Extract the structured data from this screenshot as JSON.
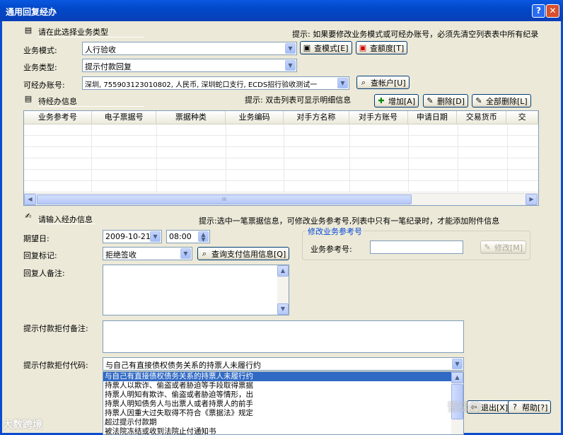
{
  "window": {
    "title": "通用回复经办",
    "help_glyph": "?",
    "close_glyph": "✕"
  },
  "section1": {
    "title": "请在此选择业务类型",
    "hint": "提示: 如果要修改业务模式或可经办账号，必须先清空列表表中所有纪录"
  },
  "form": {
    "mode_label": "业务模式:",
    "mode_value": "人行验收",
    "type_label": "业务类型:",
    "type_value": "提示付款回复",
    "account_label": "可经办账号:",
    "account_value": "深圳, 755903123010802, 人民币, 深圳蛇口支行, ECDS招行验收测试一"
  },
  "buttons": {
    "query_mode": "查模式[E]",
    "query_quota": "查额度[T]",
    "query_account": "查帐户[U]",
    "add": "增加[A]",
    "delete": "删除[D]",
    "delete_all": "全部删除[L]",
    "query_pay_info": "查询支付信用信息[Q]",
    "modify": "修改[M]",
    "exit": "退出[X]",
    "help": "帮助[?]"
  },
  "section2": {
    "title": "待经办信息",
    "hint": "提示: 双击列表可显示明细信息"
  },
  "table": {
    "columns": [
      "业务参考号",
      "电子票据号",
      "票据种类",
      "业务编码",
      "对手方名称",
      "对手方账号",
      "申请日期",
      "交易货币",
      "交"
    ],
    "scroll_thumb": "III"
  },
  "section3": {
    "title": "请输入经办信息",
    "hint": "提示:选中一笔票据信息，可修改业务参考号,列表中只有一笔纪录时，才能添加附件信息"
  },
  "entry": {
    "date_label": "期望日:",
    "date_value": "2009-10-21",
    "time_value": "08:00",
    "reply_flag_label": "回复标记:",
    "reply_flag_value": "拒绝签收",
    "remark_label": "回复人备注:",
    "reject_remark_label": "提示付款拒付备注:",
    "reject_code_label": "提示付款拒付代码:",
    "reject_code_value": "与自己有直接债权债务关系的持票人未履行约"
  },
  "modify_group": {
    "title": "修改业务参考号",
    "ref_label": "业务参考号:"
  },
  "dropdown_options": [
    "与自己有直接债权债务关系的持票人未履行约",
    "持票人以欺诈、偷盗或者胁迫等手段取得票据",
    "持票人明知有欺诈、偷盗或者胁迫等情形，出",
    "持票人明知债务人与出票人或者持票人的前手",
    "持票人因重大过失取得不符合《票据法》规定",
    "超过提示付款期",
    "被法院冻结或收到法院止付通知书"
  ],
  "watermarks": {
    "left": "大数跨境",
    "right": "晋级的"
  },
  "colors": {
    "title_bar": "#0a4bd0",
    "selection": "#316ac5",
    "group_title": "#0046d5"
  }
}
